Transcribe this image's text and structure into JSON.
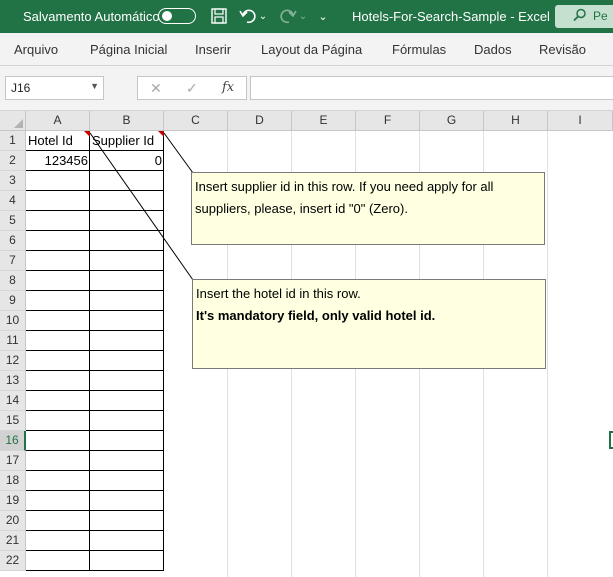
{
  "titlebar": {
    "autosave_label": "Salvamento Automático",
    "title": "Hotels-For-Search-Sample  -  Excel",
    "search_label": "Pe"
  },
  "ribbon": {
    "tabs": [
      "Arquivo",
      "Página Inicial",
      "Inserir",
      "Layout da Página",
      "Fórmulas",
      "Dados",
      "Revisão"
    ]
  },
  "formula_bar": {
    "name_box": "J16",
    "formula": ""
  },
  "columns": [
    "A",
    "B",
    "C",
    "D",
    "E",
    "F",
    "G",
    "H",
    "I"
  ],
  "rows": [
    "1",
    "2",
    "3",
    "4",
    "5",
    "6",
    "7",
    "8",
    "9",
    "10",
    "11",
    "12",
    "13",
    "14",
    "15",
    "16",
    "17",
    "18",
    "19",
    "20",
    "21",
    "22"
  ],
  "selected_row": "16",
  "cells": {
    "a1": "Hotel Id",
    "b1": "Supplier Id",
    "a2": "123456",
    "b2": "0"
  },
  "comments": {
    "supplier": {
      "line1": "Insert supplier id in this row. If you need apply for all suppliers, please, insert id \"0\" (Zero)."
    },
    "hotel": {
      "line1": "Insert the hotel id in this row.",
      "line2": "It's mandatory field, only valid hotel id."
    }
  },
  "colors": {
    "excel_green": "#217346",
    "comment_bg": "#ffffe1",
    "comment_marker": "#c00000"
  }
}
